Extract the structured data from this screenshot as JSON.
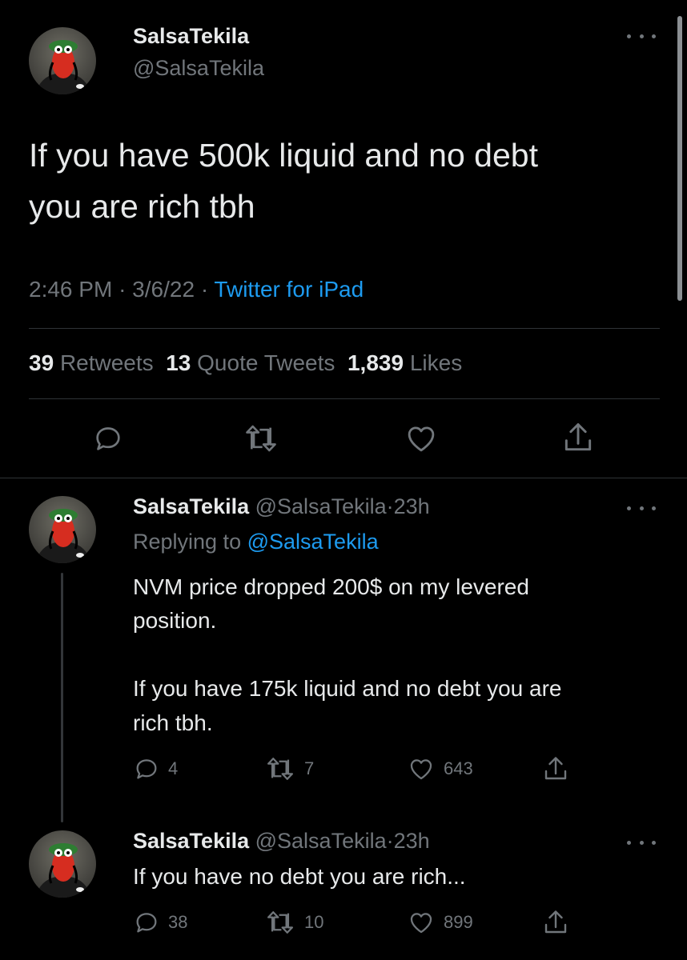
{
  "main_tweet": {
    "author": {
      "display_name": "SalsaTekila",
      "handle": "@SalsaTekila"
    },
    "text_line1": "If you have 500k liquid and no debt",
    "text_line2": "you are rich tbh",
    "time": "2:46 PM",
    "date": "3/6/22",
    "separator": "·",
    "source": "Twitter for iPad",
    "stats": {
      "retweets_count": "39",
      "retweets_label": "Retweets",
      "quotes_count": "13",
      "quotes_label": "Quote Tweets",
      "likes_count": "1,839",
      "likes_label": "Likes"
    }
  },
  "reply1": {
    "display_name": "SalsaTekila",
    "handle": "@SalsaTekila",
    "dot": "·",
    "time": "23h",
    "replying_prefix": "Replying to",
    "replying_handle": "@SalsaTekila",
    "text_p1_line1": "NVM price dropped 200$ on my levered",
    "text_p1_line2": "position.",
    "text_p2_line1": "If you have 175k liquid and no debt you are",
    "text_p2_line2": "rich tbh.",
    "actions": {
      "replies": "4",
      "retweets": "7",
      "likes": "643"
    }
  },
  "reply2": {
    "display_name": "SalsaTekila",
    "handle": "@SalsaTekila",
    "dot": "·",
    "time": "23h",
    "text": "If you have no debt you are rich...",
    "actions": {
      "replies": "38",
      "retweets": "10",
      "likes": "899"
    }
  },
  "icons": [
    "more-icon",
    "reply-icon",
    "retweet-icon",
    "like-icon",
    "share-icon"
  ],
  "colors": {
    "background": "#000000",
    "text": "#e7e9ea",
    "muted": "#71767b",
    "link": "#1d9bf0",
    "divider": "#2f3336"
  }
}
